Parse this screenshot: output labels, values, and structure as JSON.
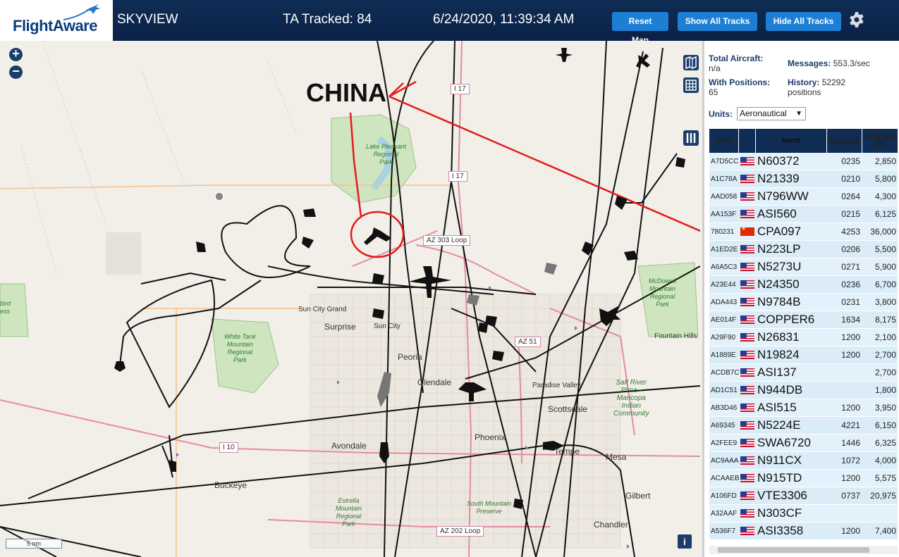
{
  "header": {
    "logo_text": "FlightAware",
    "site_name": "SKYVIEW",
    "ta_tracked": "TA Tracked: 84",
    "datetime": "6/24/2020, 11:39:34 AM",
    "buttons": {
      "reset": "Reset Map",
      "show_all": "Show All Tracks",
      "hide_all": "Hide All Tracks"
    },
    "settings_icon": "gear-icon"
  },
  "map": {
    "annotation": "CHINA",
    "scale": "5 nm",
    "info": "i",
    "zoom_in": "+",
    "zoom_out": "−",
    "places": {
      "sun_city_grand": "Sun City Grand",
      "surprise": "Surprise",
      "sun_city": "Sun City",
      "peoria": "Peoria",
      "glendale": "Glendale",
      "paradise_valley": "Paradise Valley",
      "scottsdale": "Scottsdale",
      "fountain_hills": "Fountain Hills",
      "phoenix": "Phoenix",
      "tempe": "Tempe",
      "mesa": "Mesa",
      "avondale": "Avondale",
      "buckeye": "Buckeye",
      "gilbert": "Gilbert",
      "chandler": "Chandler"
    },
    "parks": {
      "lake_pleasant": "Lake Pleasant\nRegional\nPark",
      "white_tank": "White Tank\nMountain\nRegional\nPark",
      "mcdowell": "McDowell\nMountain\nRegional\nPark",
      "estrella": "Estrella\nMountain\nRegional\nPark",
      "south_mountain": "South Mountain\nPreserve",
      "salt_river": "Salt River\nPima -\nMaricopa\nIndian\nCommunity",
      "skybird": "bird\ness"
    },
    "roads": {
      "i17_north": "I 17",
      "i17": "I 17",
      "az303": "AZ 303 Loop",
      "az51": "AZ 51",
      "i10": "I 10",
      "az202": "AZ 202 Loop"
    }
  },
  "stats": {
    "total_aircraft_label": "Total Aircraft:",
    "total_aircraft_value": "n/a",
    "with_positions_label": "With Positions:",
    "with_positions_value": "65",
    "messages_label": "Messages:",
    "messages_value": "553.3/sec",
    "history_label": "History:",
    "history_value": "52292",
    "history_unit": "positions",
    "units_label": "Units:",
    "units_value": "Aeronautical"
  },
  "table": {
    "headers": {
      "icao": "ICAO",
      "flag": "",
      "ident": "Ident",
      "squawk": "Squawk",
      "altitude": "Altitude (ft)"
    },
    "rows": [
      {
        "icao": "A7D5CC",
        "flag": "us",
        "ident": "N60372",
        "squawk": "0235",
        "altitude": "2,850"
      },
      {
        "icao": "A1C78A",
        "flag": "us",
        "ident": "N21339",
        "squawk": "0210",
        "altitude": "5,800"
      },
      {
        "icao": "AAD058",
        "flag": "us",
        "ident": "N796WW",
        "squawk": "0264",
        "altitude": "4,300"
      },
      {
        "icao": "AA153F",
        "flag": "us",
        "ident": "ASI560",
        "squawk": "0215",
        "altitude": "6,125"
      },
      {
        "icao": "780231",
        "flag": "cn",
        "ident": "CPA097",
        "squawk": "4253",
        "altitude": "36,000"
      },
      {
        "icao": "A1ED2E",
        "flag": "us",
        "ident": "N223LP",
        "squawk": "0206",
        "altitude": "5,500"
      },
      {
        "icao": "A6A5C3",
        "flag": "us",
        "ident": "N5273U",
        "squawk": "0271",
        "altitude": "5,900"
      },
      {
        "icao": "A23E44",
        "flag": "us",
        "ident": "N24350",
        "squawk": "0236",
        "altitude": "6,700"
      },
      {
        "icao": "ADA443",
        "flag": "us",
        "ident": "N9784B",
        "squawk": "0231",
        "altitude": "3,800"
      },
      {
        "icao": "AE014F",
        "flag": "us",
        "ident": "COPPER6",
        "squawk": "1634",
        "altitude": "8,175"
      },
      {
        "icao": "A29F90",
        "flag": "us",
        "ident": "N26831",
        "squawk": "1200",
        "altitude": "2,100"
      },
      {
        "icao": "A1889E",
        "flag": "us",
        "ident": "N19824",
        "squawk": "1200",
        "altitude": "2,700"
      },
      {
        "icao": "ACDB7C",
        "flag": "us",
        "ident": "ASI137",
        "squawk": "",
        "altitude": "2,700"
      },
      {
        "icao": "AD1C51",
        "flag": "us",
        "ident": "N944DB",
        "squawk": "",
        "altitude": "1,800"
      },
      {
        "icao": "AB3D46",
        "flag": "us",
        "ident": "ASI515",
        "squawk": "1200",
        "altitude": "3,950"
      },
      {
        "icao": "A69345",
        "flag": "us",
        "ident": "N5224E",
        "squawk": "4221",
        "altitude": "6,150"
      },
      {
        "icao": "A2FEE9",
        "flag": "us",
        "ident": "SWA6720",
        "squawk": "1446",
        "altitude": "6,325"
      },
      {
        "icao": "AC9AAA",
        "flag": "us",
        "ident": "N911CX",
        "squawk": "1072",
        "altitude": "4,000"
      },
      {
        "icao": "ACAAEB",
        "flag": "us",
        "ident": "N915TD",
        "squawk": "1200",
        "altitude": "5,575"
      },
      {
        "icao": "A106FD",
        "flag": "us",
        "ident": "VTE3306",
        "squawk": "0737",
        "altitude": "20,975"
      },
      {
        "icao": "A32AAF",
        "flag": "us",
        "ident": "N303CF",
        "squawk": "",
        "altitude": ""
      },
      {
        "icao": "A536F7",
        "flag": "us",
        "ident": "ASI3358",
        "squawk": "1200",
        "altitude": "7,400"
      }
    ]
  },
  "colors": {
    "header_bg": "#0f2d55",
    "button": "#1d7fd4",
    "annotation_red": "#e41b1b",
    "table_row": "#e3f1fb"
  }
}
